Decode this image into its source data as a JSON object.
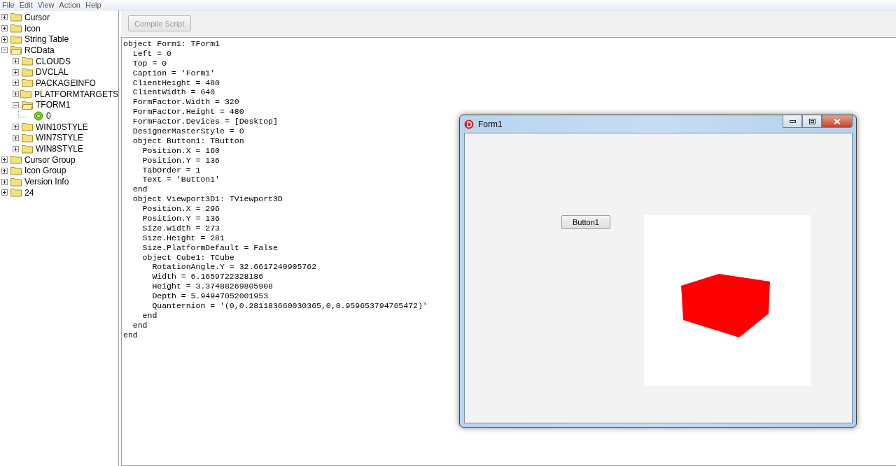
{
  "menu": [
    "File",
    "Edit",
    "View",
    "Action",
    "Help"
  ],
  "tree": [
    {
      "label": "Cursor",
      "expanded": false
    },
    {
      "label": "Icon",
      "expanded": false
    },
    {
      "label": "String Table",
      "expanded": false
    },
    {
      "label": "RCData",
      "expanded": true,
      "children": [
        {
          "label": "CLOUDS",
          "expanded": false
        },
        {
          "label": "DVCLAL",
          "expanded": false
        },
        {
          "label": "PACKAGEINFO",
          "expanded": false
        },
        {
          "label": "PLATFORMTARGETS",
          "expanded": false
        },
        {
          "label": "TFORM1",
          "expanded": true,
          "children": [
            {
              "label": "0",
              "kind": "resource"
            }
          ]
        },
        {
          "label": "WIN10STYLE",
          "expanded": false
        },
        {
          "label": "WIN7STYLE",
          "expanded": false
        },
        {
          "label": "WIN8STYLE",
          "expanded": false
        }
      ]
    },
    {
      "label": "Cursor Group",
      "expanded": false
    },
    {
      "label": "Icon Group",
      "expanded": false
    },
    {
      "label": "Version Info",
      "expanded": false
    },
    {
      "label": "24",
      "expanded": false
    }
  ],
  "toolbar": {
    "compile_button": {
      "label": "Compile Script",
      "disabled": true
    }
  },
  "code_lines": [
    "object Form1: TForm1",
    "  Left = 0",
    "  Top = 0",
    "  Caption = 'Form1'",
    "  ClientHeight = 480",
    "  ClientWidth = 640",
    "  FormFactor.Width = 320",
    "  FormFactor.Height = 480",
    "  FormFactor.Devices = [Desktop]",
    "  DesignerMasterStyle = 0",
    "  object Button1: TButton",
    "    Position.X = 160",
    "    Position.Y = 136",
    "    TabOrder = 1",
    "    Text = 'Button1'",
    "  end",
    "  object Viewport3D1: TViewport3D",
    "    Position.X = 296",
    "    Position.Y = 136",
    "    Size.Width = 273",
    "    Size.Height = 281",
    "    Size.PlatformDefault = False",
    "    object Cube1: TCube",
    "      RotationAngle.Y = 32.6617240905762",
    "      Width = 6.1659722328186",
    "      Height = 3.37488269805908",
    "      Depth = 5.94947052001953",
    "      Quanternion = '(0,0.281183660030365,0,0.959653794765472)'",
    "    end",
    "  end",
    "end"
  ],
  "preview_window": {
    "title": "Form1",
    "button": "Button1"
  }
}
